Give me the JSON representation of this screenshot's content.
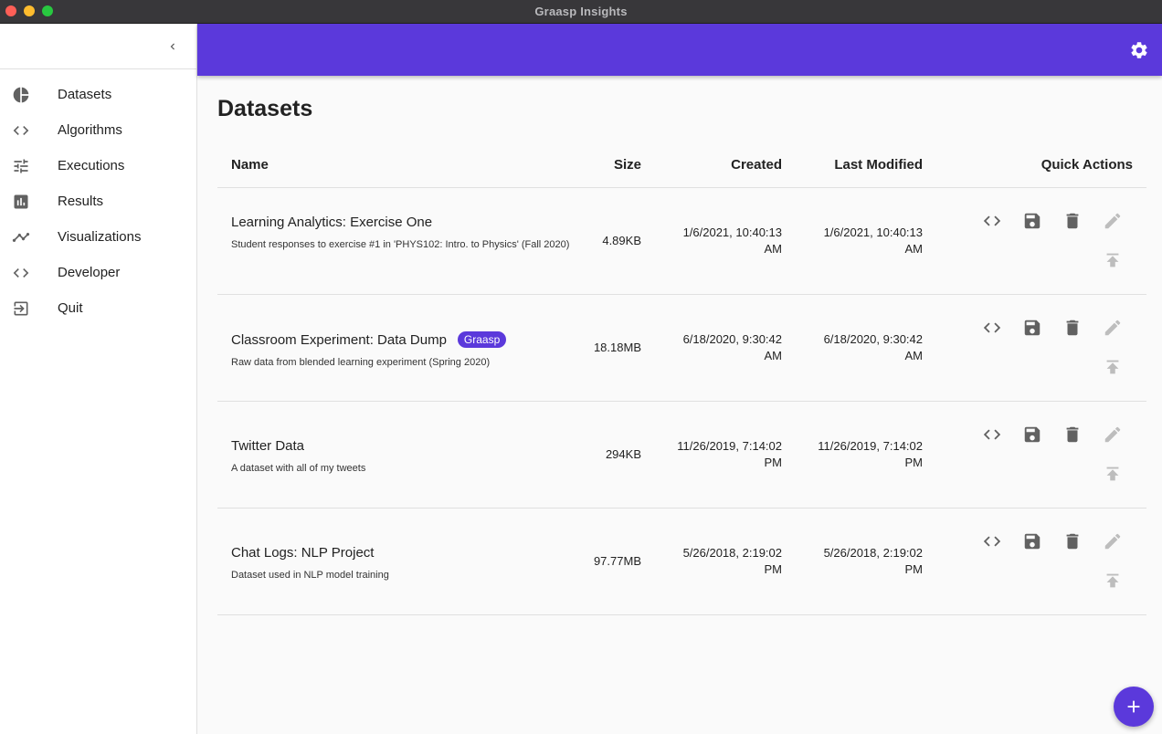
{
  "window": {
    "title": "Graasp Insights",
    "controls": [
      {
        "name": "close",
        "color": "#fe5f57"
      },
      {
        "name": "minimize",
        "color": "#febc2e"
      },
      {
        "name": "zoom",
        "color": "#28c840"
      }
    ]
  },
  "colors": {
    "accent": "#5b39db",
    "icon": "#616161",
    "icon_disabled": "#bdbdbd"
  },
  "sidebar": {
    "collapse_icon": "chevron-left-icon",
    "items": [
      {
        "label": "Datasets",
        "icon": "pie-chart-icon"
      },
      {
        "label": "Algorithms",
        "icon": "code-icon"
      },
      {
        "label": "Executions",
        "icon": "tune-icon"
      },
      {
        "label": "Results",
        "icon": "bar-chart-icon"
      },
      {
        "label": "Visualizations",
        "icon": "trending-line-icon"
      },
      {
        "label": "Developer",
        "icon": "code-icon"
      },
      {
        "label": "Quit",
        "icon": "exit-icon"
      }
    ]
  },
  "appbar": {
    "settings_icon": "gear-icon"
  },
  "page": {
    "title": "Datasets"
  },
  "table": {
    "headers": {
      "name": "Name",
      "size": "Size",
      "created": "Created",
      "modified": "Last Modified",
      "actions": "Quick Actions"
    },
    "rows": [
      {
        "name": "Learning Analytics: Exercise One",
        "badge": "",
        "description": "Student responses to exercise #1 in 'PHYS102: Intro. to Physics' (Fall 2020)",
        "size": "4.89KB",
        "created": "1/6/2021, 10:40:13 AM",
        "modified": "1/6/2021, 10:40:13 AM"
      },
      {
        "name": "Classroom Experiment: Data Dump",
        "badge": "Graasp",
        "description": "Raw data from blended learning experiment (Spring 2020)",
        "size": "18.18MB",
        "created": "6/18/2020, 9:30:42 AM",
        "modified": "6/18/2020, 9:30:42 AM"
      },
      {
        "name": "Twitter Data",
        "badge": "",
        "description": "A dataset with all of my tweets",
        "size": "294KB",
        "created": "11/26/2019, 7:14:02 PM",
        "modified": "11/26/2019, 7:14:02 PM"
      },
      {
        "name": "Chat Logs: NLP Project",
        "badge": "",
        "description": "Dataset used in NLP model training",
        "size": "97.77MB",
        "created": "5/26/2018, 2:19:02 PM",
        "modified": "5/26/2018, 2:19:02 PM"
      }
    ],
    "quick_action_icons": [
      "code-icon",
      "save-icon",
      "delete-icon",
      "edit-icon",
      "publish-icon"
    ]
  },
  "fab": {
    "icon": "add-icon"
  }
}
